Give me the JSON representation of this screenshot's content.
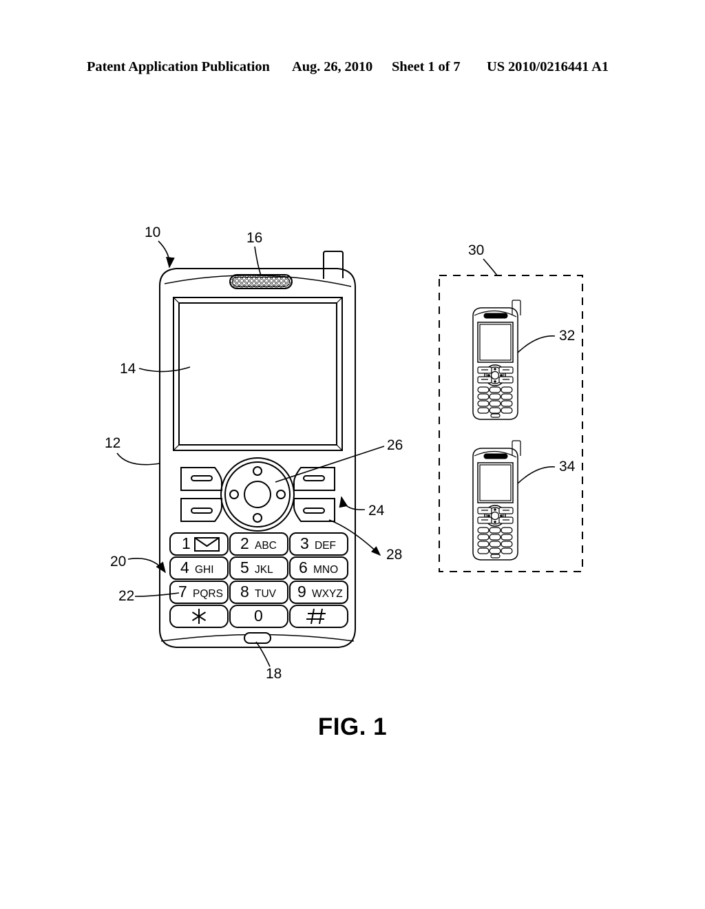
{
  "header": {
    "publication": "Patent Application Publication",
    "date": "Aug. 26, 2010",
    "sheet": "Sheet 1 of 7",
    "patent_number": "US 2010/0216441 A1"
  },
  "figure": {
    "caption": "FIG. 1"
  },
  "reference_numerals": {
    "device": "10",
    "housing": "12",
    "display": "14",
    "speaker": "16",
    "microphone": "18",
    "keypad": "20",
    "key": "22",
    "soft_key": "24",
    "navigation": "26",
    "function_key": "28",
    "group": "30",
    "device_variant_a": "32",
    "device_variant_b": "34"
  },
  "keypad": {
    "keys": [
      {
        "num": "1",
        "alpha": "",
        "icon": "envelope-icon"
      },
      {
        "num": "2",
        "alpha": "ABC",
        "icon": ""
      },
      {
        "num": "3",
        "alpha": "DEF",
        "icon": ""
      },
      {
        "num": "4",
        "alpha": "GHI",
        "icon": ""
      },
      {
        "num": "5",
        "alpha": "JKL",
        "icon": ""
      },
      {
        "num": "6",
        "alpha": "MNO",
        "icon": ""
      },
      {
        "num": "7",
        "alpha": "PQRS",
        "icon": ""
      },
      {
        "num": "8",
        "alpha": "TUV",
        "icon": ""
      },
      {
        "num": "9",
        "alpha": "WXYZ",
        "icon": ""
      },
      {
        "num": "",
        "alpha": "",
        "icon": "asterisk-icon"
      },
      {
        "num": "0",
        "alpha": "",
        "icon": ""
      },
      {
        "num": "",
        "alpha": "",
        "icon": "hash-icon"
      }
    ]
  },
  "colors": {
    "ink": "#000000",
    "paper": "#ffffff"
  }
}
